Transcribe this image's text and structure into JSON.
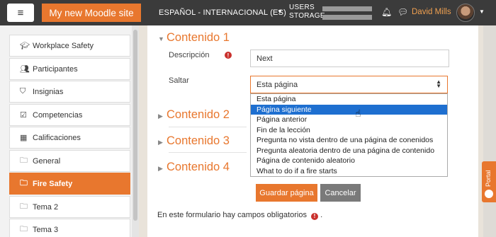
{
  "navbar": {
    "menu_icon": "hamburger-icon",
    "site_name": "My new Moodle site",
    "language": "ESPAÑOL - INTERNACIONAL (ES)",
    "storage_label_1": "USERS",
    "storage_label_2": "STORAGE",
    "bell_icon": "bell-icon",
    "chat_icon": "chat-icon",
    "user_name": "David Mills"
  },
  "sidebar": {
    "items": [
      {
        "label": "Workplace Safety",
        "icon": "mortarboard-icon"
      },
      {
        "label": "Participantes",
        "icon": "users-icon"
      },
      {
        "label": "Insignias",
        "icon": "shield-icon"
      },
      {
        "label": "Competencias",
        "icon": "checkbox-icon"
      },
      {
        "label": "Calificaciones",
        "icon": "table-icon"
      },
      {
        "label": "General",
        "icon": "folder-icon"
      },
      {
        "label": "Fire Safety",
        "icon": "folder-icon"
      },
      {
        "label": "Tema 2",
        "icon": "folder-icon"
      },
      {
        "label": "Tema 3",
        "icon": "folder-icon"
      }
    ],
    "active_label": "Fire Safety"
  },
  "main": {
    "sections": [
      {
        "title": "Contenido 1",
        "expanded": true
      },
      {
        "title": "Contenido 2",
        "expanded": false
      },
      {
        "title": "Contenido 3",
        "expanded": false
      },
      {
        "title": "Contenido 4",
        "expanded": false
      }
    ],
    "description_label": "Descripción",
    "description_value": "Next",
    "jump_label": "Saltar",
    "jump_selected": "Esta página",
    "jump_options": [
      "Esta página",
      "Página siguiente",
      "Página anterior",
      "Fin de la lección",
      "Pregunta no vista dentro de una página de conenidos",
      "Pregunta aleatoria dentro de una página de contenido",
      "Página de contenido aleatorio",
      "What to do if a fire starts"
    ],
    "highlighted_option": "Página siguiente",
    "save_button": "Guardar página",
    "cancel_button": "Cancelar",
    "required_note": "En este formulario hay campos obligatorios",
    "required_note_end": "."
  },
  "portal_tab": "Portal",
  "colors": {
    "accent": "#e8772e",
    "navbar": "#3b3b3b",
    "highlight": "#1e6fd0",
    "required": "#c9302c"
  }
}
